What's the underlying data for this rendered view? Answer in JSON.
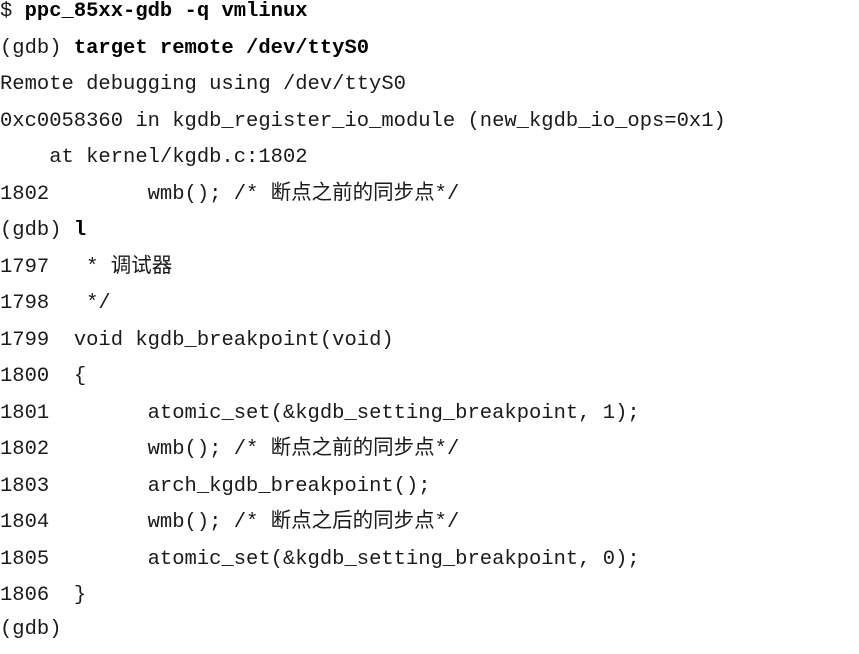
{
  "session": {
    "l1_prompt": "$ ",
    "l1_cmd": "ppc_85xx-gdb -q vmlinux",
    "l2_prompt": "(gdb) ",
    "l2_cmd": "target remote /dev/ttyS0",
    "l3": "Remote debugging using /dev/ttyS0",
    "l4": "0xc0058360 in kgdb_register_io_module (new_kgdb_io_ops=0x1)",
    "l5": "    at kernel/kgdb.c:1802",
    "l6_num": "1802",
    "l6_code": "        wmb(); /* 断点之前的同步点*/",
    "l7_prompt": "(gdb) ",
    "l7_cmd": "l",
    "listing": [
      {
        "num": "1797",
        "code": "   * 调试器"
      },
      {
        "num": "1798",
        "code": "   */"
      },
      {
        "num": "1799",
        "code": "  void kgdb_breakpoint(void)"
      },
      {
        "num": "1800",
        "code": "  {"
      },
      {
        "num": "1801",
        "code": "        atomic_set(&kgdb_setting_breakpoint, 1);"
      },
      {
        "num": "1802",
        "code": "        wmb(); /* 断点之前的同步点*/"
      },
      {
        "num": "1803",
        "code": "        arch_kgdb_breakpoint();"
      },
      {
        "num": "1804",
        "code": "        wmb(); /* 断点之后的同步点*/"
      },
      {
        "num": "1805",
        "code": "        atomic_set(&kgdb_setting_breakpoint, 0);"
      },
      {
        "num": "1806",
        "code": "  }"
      }
    ],
    "last_prompt": "(gdb)"
  }
}
